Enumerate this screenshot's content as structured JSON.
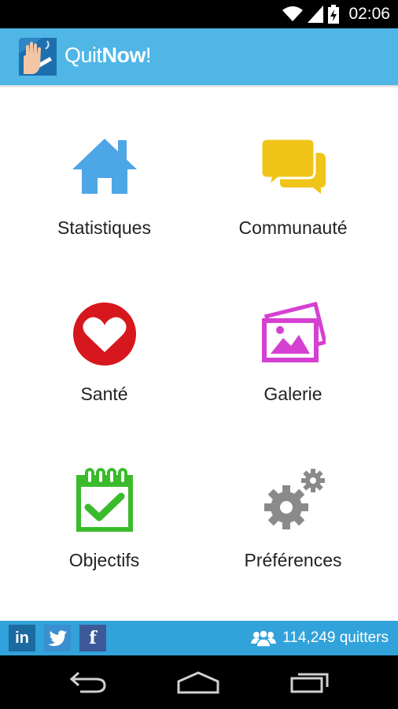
{
  "status_bar": {
    "time": "02:06",
    "icons": [
      "wifi-icon",
      "signal-icon",
      "battery-charging-icon"
    ]
  },
  "app_bar": {
    "title_regular": "Quit",
    "title_bold": "Now",
    "title_suffix": "!",
    "logo": "quitnow-logo"
  },
  "menu": [
    {
      "id": "statistiques",
      "label": "Statistiques",
      "icon": "home-icon",
      "color": "#4da6e6"
    },
    {
      "id": "communaute",
      "label": "Communauté",
      "icon": "chat-bubbles-icon",
      "color": "#f0c419"
    },
    {
      "id": "sante",
      "label": "Santé",
      "icon": "heart-icon",
      "color": "#d6171d"
    },
    {
      "id": "galerie",
      "label": "Galerie",
      "icon": "gallery-icon",
      "color": "#d640d2"
    },
    {
      "id": "objectifs",
      "label": "Objectifs",
      "icon": "calendar-check-icon",
      "color": "#3bbb2b"
    },
    {
      "id": "preferences",
      "label": "Préférences",
      "icon": "gears-icon",
      "color": "#8a8a8a"
    }
  ],
  "footer": {
    "social": [
      {
        "name": "linkedin",
        "label": "in"
      },
      {
        "name": "twitter",
        "label": ""
      },
      {
        "name": "facebook",
        "label": "f"
      }
    ],
    "quitters_text": "114,249 quitters"
  },
  "colors": {
    "app_bar": "#4fb6e6",
    "footer": "#31a2da"
  }
}
